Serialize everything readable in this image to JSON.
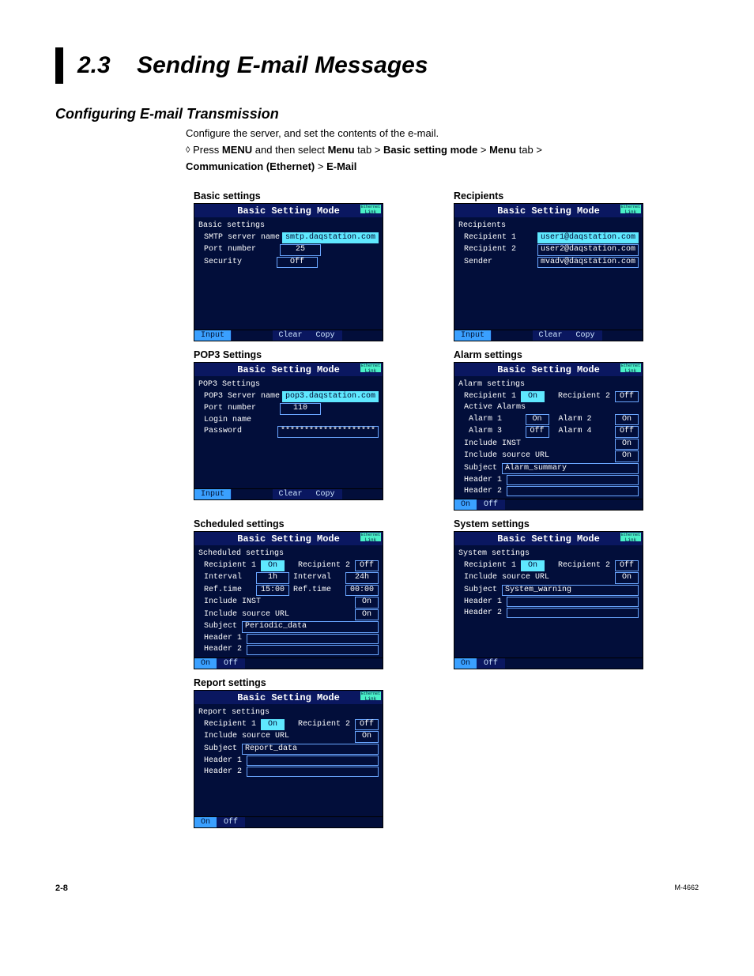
{
  "page": {
    "section_number": "2.3",
    "section_title": "Sending E-mail Messages",
    "subheading": "Configuring E-mail Transmission",
    "intro_line": "Configure the server, and set the contents of the e-mail.",
    "nav_prefix": "Press ",
    "nav_menu": "MENU",
    "nav_mid1": " and then select ",
    "nav_menu_tab": "Menu",
    "nav_mid2": " tab > ",
    "nav_bsm": "Basic setting mode",
    "nav_mid3": " > ",
    "nav_menu_tab2": "Menu",
    "nav_mid4": " tab > ",
    "nav_comm": "Communication (Ethernet)",
    "nav_mid5": " > ",
    "nav_email": "E-Mail"
  },
  "labels": {
    "basic_settings": "Basic settings",
    "recipients": "Recipients",
    "pop3_settings": "POP3 Settings",
    "alarm_settings": "Alarm settings",
    "scheduled_settings": "Scheduled settings",
    "system_settings": "System settings",
    "report_settings": "Report settings"
  },
  "mode_title": "Basic Setting Mode",
  "eth_link": "Link",
  "btns": {
    "input": "Input",
    "clear": "Clear",
    "copy": "Copy",
    "on": "On",
    "off": "Off"
  },
  "basic": {
    "heading": "Basic settings",
    "l1": "SMTP server name",
    "v1": "smtp.daqstation.com",
    "l2": "Port number",
    "v2": "25",
    "l3": "Security",
    "v3": "Off"
  },
  "recip": {
    "heading": "Recipients",
    "l1": "Recipient 1",
    "v1": "user1@daqstation.com",
    "l2": "Recipient 2",
    "v2": "user2@daqstation.com",
    "l3": "Sender",
    "v3": "mvadv@daqstation.com"
  },
  "pop3": {
    "heading": "POP3 Settings",
    "l1": "POP3 Server name",
    "v1": "pop3.daqstation.com",
    "l2": "Port number",
    "v2": "110",
    "l3": "Login name",
    "l4": "Password",
    "v4": "********************"
  },
  "alarm": {
    "heading": "Alarm settings",
    "r1": "Recipient 1",
    "r1v": "On",
    "r2": "Recipient 2",
    "r2v": "Off",
    "active": "Active Alarms",
    "a1": "Alarm 1",
    "a1v": "On",
    "a2": "Alarm 2",
    "a2v": "On",
    "a3": "Alarm 3",
    "a3v": "Off",
    "a4": "Alarm 4",
    "a4v": "Off",
    "inc_inst": "Include INST",
    "inc_inst_v": "On",
    "inc_url": "Include source URL",
    "inc_url_v": "On",
    "subject": "Subject",
    "subject_v": "Alarm_summary",
    "h1": "Header 1",
    "h2": "Header 2"
  },
  "sched": {
    "heading": "Scheduled settings",
    "r1": "Recipient 1",
    "r1v": "On",
    "r2": "Recipient 2",
    "r2v": "Off",
    "int1": "Interval",
    "int1v": "1h",
    "int2": "Interval",
    "int2v": "24h",
    "ref1": "Ref.time",
    "ref1v": "15:00",
    "ref2": "Ref.time",
    "ref2v": "00:00",
    "inc_inst": "Include INST",
    "inc_inst_v": "On",
    "inc_url": "Include source URL",
    "inc_url_v": "On",
    "subject": "Subject",
    "subject_v": "Periodic_data",
    "h1": "Header 1",
    "h2": "Header 2"
  },
  "system": {
    "heading": "System settings",
    "r1": "Recipient 1",
    "r1v": "On",
    "r2": "Recipient 2",
    "r2v": "Off",
    "inc_url": "Include source URL",
    "inc_url_v": "On",
    "subject": "Subject",
    "subject_v": "System_warning",
    "h1": "Header 1",
    "h2": "Header 2"
  },
  "report": {
    "heading": "Report settings",
    "r1": "Recipient 1",
    "r1v": "On",
    "r2": "Recipient 2",
    "r2v": "Off",
    "inc_url": "Include source URL",
    "inc_url_v": "On",
    "subject": "Subject",
    "subject_v": "Report_data",
    "h1": "Header 1",
    "h2": "Header 2"
  },
  "footer": {
    "page": "2-8",
    "docid": "M-4662"
  }
}
